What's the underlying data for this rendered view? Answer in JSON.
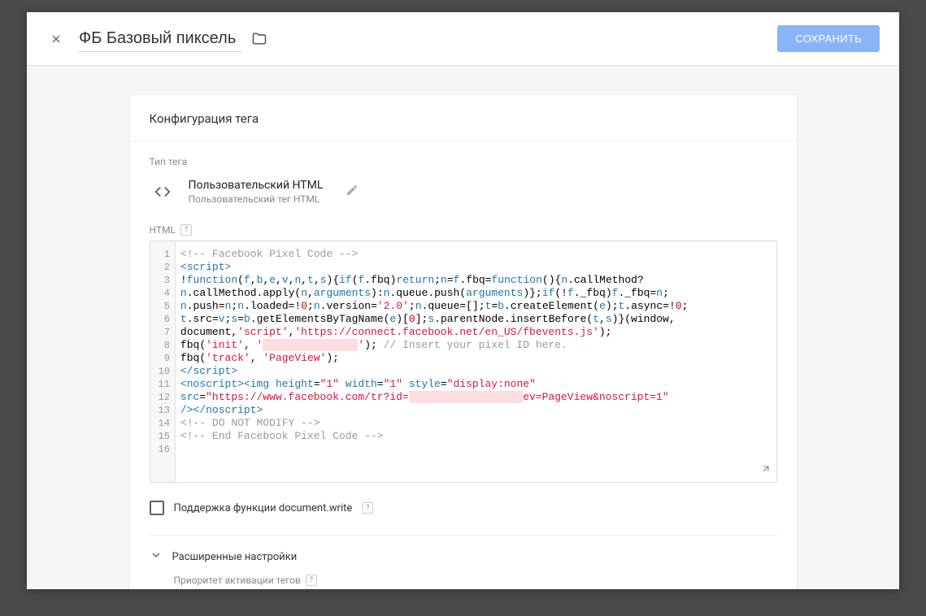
{
  "header": {
    "title": "ФБ Базовый пиксель",
    "save_label": "СОХРАНИТЬ"
  },
  "config": {
    "title": "Конфигурация тега",
    "type_label": "Тип тега",
    "tag_type_title": "Пользовательский HTML",
    "tag_type_sub": "Пользовательский тег HTML",
    "html_label": "HTML",
    "docwrite_label": "Поддержка функции document.write",
    "advanced_label": "Расширенные настройки",
    "priority_label": "Приоритет активации тегов"
  },
  "code": {
    "lines": 16,
    "version": "'2.0'",
    "sdk_url": "'https://connect.facebook.net/en_US/fbevents.js'",
    "init": "'init'",
    "track": "'track'",
    "pageview": "'PageView'",
    "comment_insert": "// Insert your pixel ID here.",
    "height_attr": "\"1\"",
    "width_attr": "\"1\"",
    "style_attr": "\"display:none\"",
    "src_prefix": "\"https://www.facebook.com/tr?id=",
    "src_suffix": "ev=PageView&noscript=1\"",
    "comment_start": "<!-- Facebook Pixel Code -->",
    "comment_nomodify": "<!-- DO NOT MODIFY -->",
    "comment_end": "<!-- End Facebook Pixel Code -->"
  }
}
